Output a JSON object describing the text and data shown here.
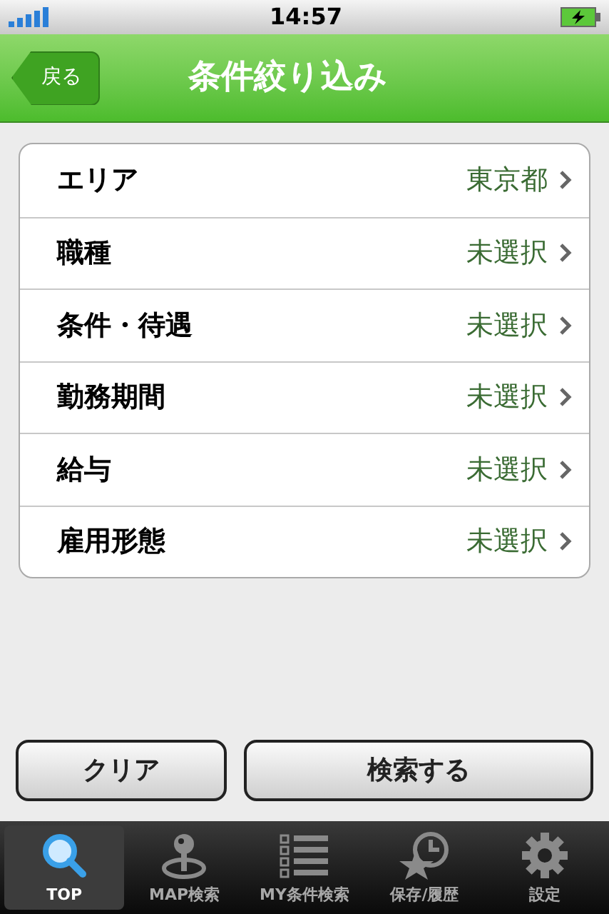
{
  "status_bar": {
    "time": "14:57"
  },
  "nav_bar": {
    "back": "戻る",
    "title": "条件絞り込み"
  },
  "filters": [
    {
      "label": "エリア",
      "value": "東京都"
    },
    {
      "label": "職種",
      "value": "未選択"
    },
    {
      "label": "条件・待遇",
      "value": "未選択"
    },
    {
      "label": "勤務期間",
      "value": "未選択"
    },
    {
      "label": "給与",
      "value": "未選択"
    },
    {
      "label": "雇用形態",
      "value": "未選択"
    }
  ],
  "buttons": [
    "クリア",
    "検索する"
  ],
  "tab_bar": [
    {
      "label": "TOP",
      "kind": "search",
      "selected": true
    },
    {
      "label": "MAP検索",
      "kind": "pin",
      "selected": false
    },
    {
      "label": "MY条件検索",
      "kind": "checklist",
      "selected": false
    },
    {
      "label": "保存/履歴",
      "kind": "history",
      "selected": false
    },
    {
      "label": "設定",
      "kind": "settings",
      "selected": false
    }
  ]
}
